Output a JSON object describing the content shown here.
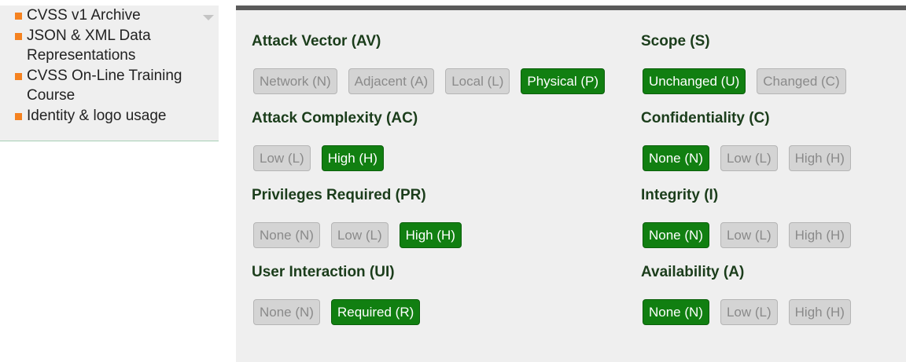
{
  "sidebar": {
    "items": [
      {
        "label": "CVSS v1 Archive"
      },
      {
        "label": "JSON & XML Data Representations"
      },
      {
        "label": "CVSS On-Line Training Course"
      },
      {
        "label": "Identity & logo usage"
      }
    ]
  },
  "colors": {
    "selected": "#117f11",
    "unselected": "#d4d4d4",
    "bullet": "#f58220",
    "heading": "#1b3d1b"
  },
  "left_metrics": [
    {
      "title": "Attack Vector (AV)",
      "options": [
        {
          "label": "Network (N)",
          "selected": false
        },
        {
          "label": "Adjacent (A)",
          "selected": false
        },
        {
          "label": "Local (L)",
          "selected": false
        },
        {
          "label": "Physical (P)",
          "selected": true
        }
      ]
    },
    {
      "title": "Attack Complexity (AC)",
      "options": [
        {
          "label": "Low (L)",
          "selected": false
        },
        {
          "label": "High (H)",
          "selected": true
        }
      ]
    },
    {
      "title": "Privileges Required (PR)",
      "options": [
        {
          "label": "None (N)",
          "selected": false
        },
        {
          "label": "Low (L)",
          "selected": false
        },
        {
          "label": "High (H)",
          "selected": true
        }
      ]
    },
    {
      "title": "User Interaction (UI)",
      "options": [
        {
          "label": "None (N)",
          "selected": false
        },
        {
          "label": "Required (R)",
          "selected": true
        }
      ]
    }
  ],
  "right_metrics": [
    {
      "title": "Scope (S)",
      "options": [
        {
          "label": "Unchanged (U)",
          "selected": true
        },
        {
          "label": "Changed (C)",
          "selected": false
        }
      ]
    },
    {
      "title": "Confidentiality (C)",
      "options": [
        {
          "label": "None (N)",
          "selected": true
        },
        {
          "label": "Low (L)",
          "selected": false
        },
        {
          "label": "High (H)",
          "selected": false
        }
      ]
    },
    {
      "title": "Integrity (I)",
      "options": [
        {
          "label": "None (N)",
          "selected": true
        },
        {
          "label": "Low (L)",
          "selected": false
        },
        {
          "label": "High (H)",
          "selected": false
        }
      ]
    },
    {
      "title": "Availability (A)",
      "options": [
        {
          "label": "None (N)",
          "selected": true
        },
        {
          "label": "Low (L)",
          "selected": false
        },
        {
          "label": "High (H)",
          "selected": false
        }
      ]
    }
  ]
}
